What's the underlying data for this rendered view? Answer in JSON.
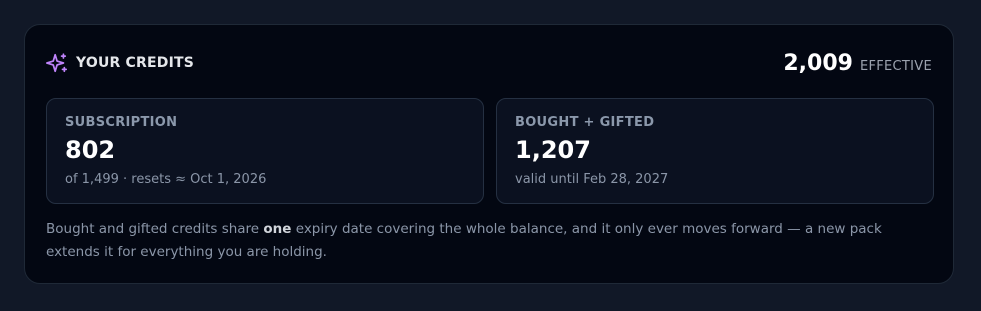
{
  "credits": {
    "title": "YOUR CREDITS",
    "total": "2,009",
    "total_label": "EFFECTIVE",
    "icon": "sparkle-icon",
    "accent_color": "#c084fc",
    "subscription": {
      "label": "SUBSCRIPTION",
      "value": "802",
      "subtitle": "of 1,499 · resets ≈ Oct 1, 2026"
    },
    "bought": {
      "label": "BOUGHT + GIFTED",
      "value": "1,207",
      "subtitle": "valid until Feb 28, 2027"
    },
    "note": {
      "before": "Bought and gifted credits share ",
      "emphasis": "one",
      "after": " expiry date covering the whole balance, and it only ever moves forward — a new pack extends it for everything you are holding."
    }
  }
}
